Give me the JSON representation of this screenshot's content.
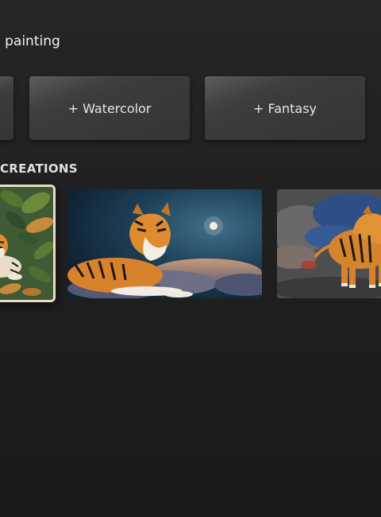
{
  "header": {
    "prompt_title": "l painting"
  },
  "style_chips": [
    {
      "label": ""
    },
    {
      "label": "+ Watercolor"
    },
    {
      "label": "+ Fantasy"
    }
  ],
  "creations": {
    "heading": "CREATIONS",
    "items": [
      {
        "subject": "tiger in jungle leaves",
        "selected": true
      },
      {
        "subject": "tiger resting on clouds under moon",
        "selected": false
      },
      {
        "subject": "tiger walking in stormy sky",
        "selected": false
      }
    ]
  },
  "colors": {
    "background": "#1b1b1b",
    "chip": "#3c3c3c",
    "selected_border": "#e9dcc4",
    "text": "#f2f2f2"
  }
}
